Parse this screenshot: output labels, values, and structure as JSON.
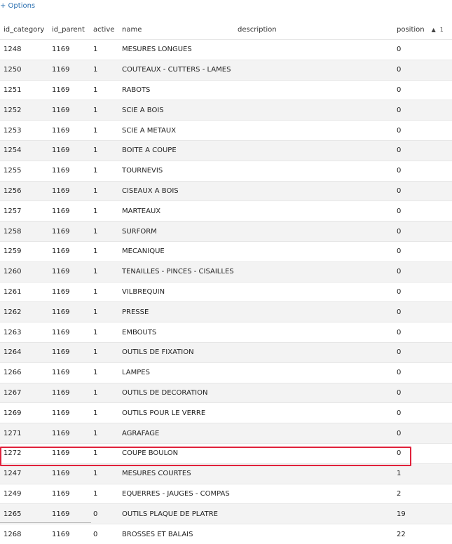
{
  "options_label": "+ Options",
  "columns": {
    "id_category": "id_category",
    "id_parent": "id_parent",
    "active": "active",
    "name": "name",
    "description": "description",
    "position": "position",
    "sort_arrow": "▲",
    "sort_index": "1"
  },
  "rows": [
    {
      "id_category": "1248",
      "id_parent": "1169",
      "active": "1",
      "name": "MESURES LONGUES",
      "description": "",
      "position": "0"
    },
    {
      "id_category": "1250",
      "id_parent": "1169",
      "active": "1",
      "name": "COUTEAUX - CUTTERS - LAMES",
      "description": "",
      "position": "0"
    },
    {
      "id_category": "1251",
      "id_parent": "1169",
      "active": "1",
      "name": "RABOTS",
      "description": "",
      "position": "0"
    },
    {
      "id_category": "1252",
      "id_parent": "1169",
      "active": "1",
      "name": "SCIE A BOIS",
      "description": "",
      "position": "0"
    },
    {
      "id_category": "1253",
      "id_parent": "1169",
      "active": "1",
      "name": "SCIE A METAUX",
      "description": "",
      "position": "0"
    },
    {
      "id_category": "1254",
      "id_parent": "1169",
      "active": "1",
      "name": "BOITE A COUPE",
      "description": "",
      "position": "0"
    },
    {
      "id_category": "1255",
      "id_parent": "1169",
      "active": "1",
      "name": "TOURNEVIS",
      "description": "",
      "position": "0"
    },
    {
      "id_category": "1256",
      "id_parent": "1169",
      "active": "1",
      "name": "CISEAUX A BOIS",
      "description": "",
      "position": "0"
    },
    {
      "id_category": "1257",
      "id_parent": "1169",
      "active": "1",
      "name": "MARTEAUX",
      "description": "",
      "position": "0"
    },
    {
      "id_category": "1258",
      "id_parent": "1169",
      "active": "1",
      "name": "SURFORM",
      "description": "",
      "position": "0"
    },
    {
      "id_category": "1259",
      "id_parent": "1169",
      "active": "1",
      "name": "MECANIQUE",
      "description": "",
      "position": "0"
    },
    {
      "id_category": "1260",
      "id_parent": "1169",
      "active": "1",
      "name": "TENAILLES - PINCES - CISAILLES",
      "description": "",
      "position": "0"
    },
    {
      "id_category": "1261",
      "id_parent": "1169",
      "active": "1",
      "name": "VILBREQUIN",
      "description": "",
      "position": "0"
    },
    {
      "id_category": "1262",
      "id_parent": "1169",
      "active": "1",
      "name": "PRESSE",
      "description": "",
      "position": "0"
    },
    {
      "id_category": "1263",
      "id_parent": "1169",
      "active": "1",
      "name": "EMBOUTS",
      "description": "",
      "position": "0"
    },
    {
      "id_category": "1264",
      "id_parent": "1169",
      "active": "1",
      "name": "OUTILS DE FIXATION",
      "description": "",
      "position": "0"
    },
    {
      "id_category": "1266",
      "id_parent": "1169",
      "active": "1",
      "name": "LAMPES",
      "description": "",
      "position": "0"
    },
    {
      "id_category": "1267",
      "id_parent": "1169",
      "active": "1",
      "name": "OUTILS DE DECORATION",
      "description": "",
      "position": "0"
    },
    {
      "id_category": "1269",
      "id_parent": "1169",
      "active": "1",
      "name": "OUTILS POUR LE VERRE",
      "description": "",
      "position": "0"
    },
    {
      "id_category": "1271",
      "id_parent": "1169",
      "active": "1",
      "name": "AGRAFAGE",
      "description": "",
      "position": "0"
    },
    {
      "id_category": "1272",
      "id_parent": "1169",
      "active": "1",
      "name": "COUPE BOULON",
      "description": "",
      "position": "0"
    },
    {
      "id_category": "1247",
      "id_parent": "1169",
      "active": "1",
      "name": "MESURES COURTES",
      "description": "",
      "position": "1"
    },
    {
      "id_category": "1249",
      "id_parent": "1169",
      "active": "1",
      "name": "EQUERRES - JAUGES - COMPAS",
      "description": "",
      "position": "2"
    },
    {
      "id_category": "1265",
      "id_parent": "1169",
      "active": "0",
      "name": "OUTILS PLAQUE DE PLATRE",
      "description": "",
      "position": "19"
    },
    {
      "id_category": "1268",
      "id_parent": "1169",
      "active": "0",
      "name": "BROSSES ET BALAIS",
      "description": "",
      "position": "22"
    }
  ],
  "colors": {
    "link": "#2a6fb0",
    "highlight_border": "#e0213b",
    "stripe": "#f3f3f3"
  }
}
